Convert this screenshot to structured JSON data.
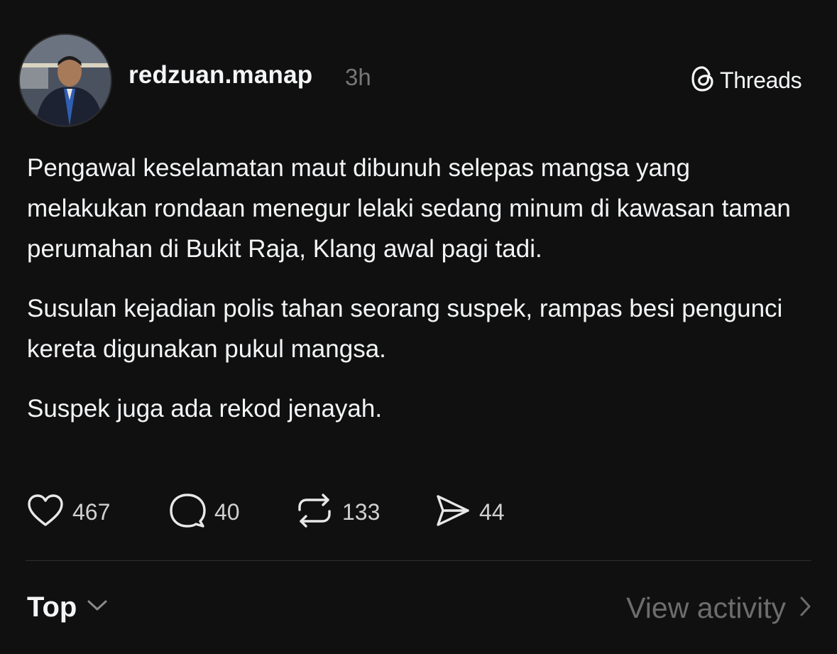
{
  "post": {
    "username": "redzuan.manap",
    "time": "3h",
    "paragraphs": [
      "Pengawal keselamatan maut dibunuh selepas mangsa yang melakukan rondaan menegur lelaki sedang minum di kawasan taman perumahan di Bukit Raja, Klang awal pagi tadi.",
      "Susulan kejadian polis tahan seorang suspek, rampas besi pengunci kereta digunakan pukul mangsa.",
      "Suspek juga ada rekod jenayah."
    ]
  },
  "brand": {
    "label": "Threads",
    "icon": "threads-logo-icon"
  },
  "actions": {
    "likes": "467",
    "replies": "40",
    "reposts": "133",
    "shares": "44"
  },
  "footer": {
    "sort_label": "Top",
    "activity_label": "View activity"
  },
  "colors": {
    "background": "#101010",
    "text": "#f3f5f7",
    "muted": "#777777"
  }
}
